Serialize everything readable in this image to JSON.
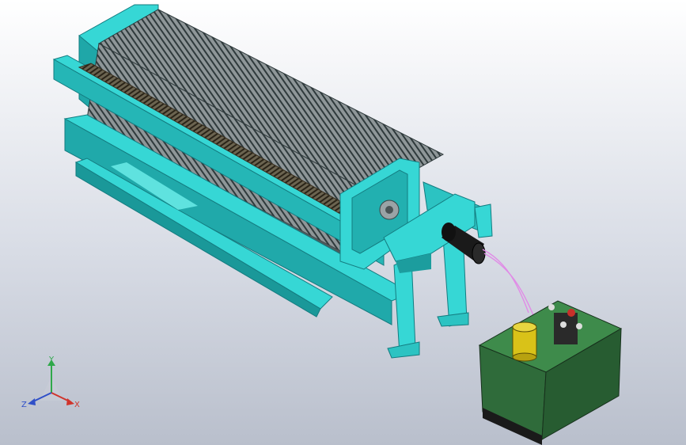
{
  "viewport": {
    "background_top": "#ffffff",
    "background_bottom": "#b9bfcc"
  },
  "model": {
    "frame_color": "#36d7d5",
    "frame_shadow": "#1b9a9c",
    "plate_color": "#5d6a6d",
    "tank_color": "#2f6b3a",
    "tank_shadow": "#214a29",
    "motor_color": "#d9c218",
    "hose_color": "#e08be6"
  },
  "triad": {
    "x_label": "X",
    "y_label": "Y",
    "z_label": "Z",
    "x_color": "#d0342c",
    "y_color": "#2fa84a",
    "z_color": "#3050c8"
  }
}
